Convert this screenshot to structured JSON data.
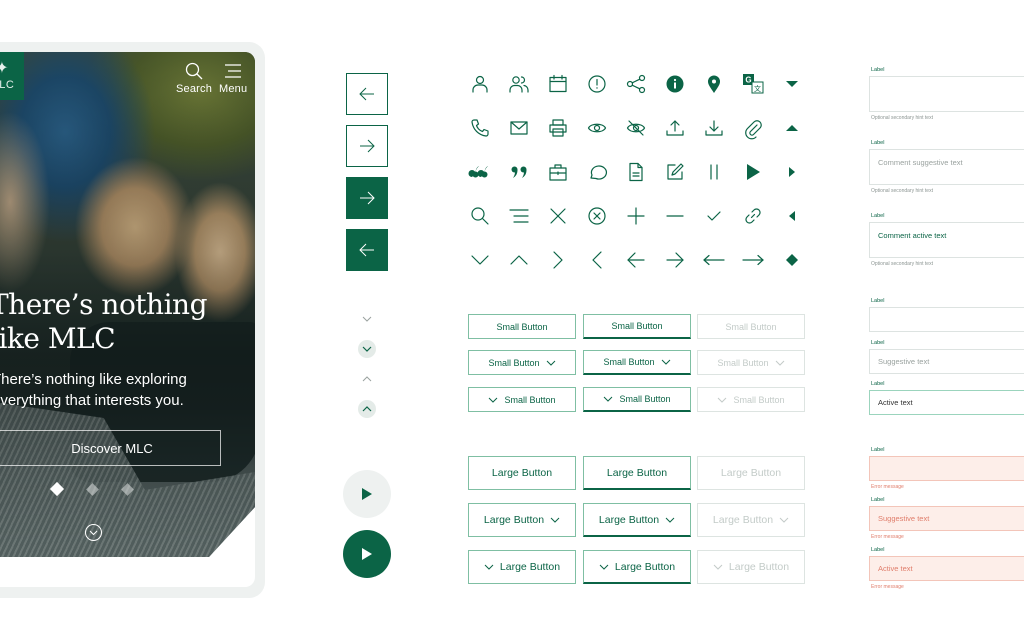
{
  "phone": {
    "logo_text": "MLC",
    "search_label": "Search",
    "menu_label": "Menu",
    "hero_title_line1": "There’s nothing",
    "hero_title_line2": "like MLC",
    "hero_sub_line1": "There’s nothing like exploring",
    "hero_sub_line2": "everything that interests you.",
    "cta_label": "Discover MLC",
    "carousel": {
      "count": 3,
      "active_index": 0
    }
  },
  "nav_buttons": [
    {
      "icon": "arrow-left-icon",
      "style": "outline"
    },
    {
      "icon": "arrow-right-icon",
      "style": "outline"
    },
    {
      "icon": "arrow-right-icon",
      "style": "filled"
    },
    {
      "icon": "arrow-left-icon",
      "style": "filled"
    }
  ],
  "chevron_buttons": [
    {
      "icon": "chevron-down-icon",
      "state": "default"
    },
    {
      "icon": "chevron-down-icon",
      "state": "hover"
    },
    {
      "icon": "chevron-up-icon",
      "state": "default"
    },
    {
      "icon": "chevron-up-icon",
      "state": "hover"
    }
  ],
  "play_buttons": [
    {
      "icon": "play-icon",
      "style": "light"
    },
    {
      "icon": "play-icon",
      "style": "dark"
    }
  ],
  "icon_grid": [
    [
      "user-icon",
      "users-icon",
      "calendar-icon",
      "alert-circle-icon",
      "share-icon",
      "info-filled-icon",
      "location-pin-icon",
      "google-translate-icon",
      "caret-down-icon"
    ],
    [
      "phone-icon",
      "mail-icon",
      "printer-icon",
      "eye-icon",
      "eye-off-icon",
      "upload-icon",
      "download-icon",
      "paperclip-icon",
      "caret-up-icon"
    ],
    [
      "quote-open-icon",
      "quote-close-icon",
      "briefcase-icon",
      "chat-bubble-icon",
      "document-icon",
      "edit-icon",
      "pause-icon",
      "play-large-icon",
      "caret-right-icon"
    ],
    [
      "search-icon",
      "menu-icon",
      "close-icon",
      "close-circle-icon",
      "plus-icon",
      "minus-icon",
      "check-icon",
      "link-icon",
      "caret-left-icon"
    ],
    [
      "chevron-down-icon",
      "chevron-up-icon",
      "chevron-right-icon",
      "chevron-left-icon",
      "arrow-left-icon",
      "arrow-right-icon",
      "long-arrow-left-icon",
      "long-arrow-right-icon",
      "diamond-icon"
    ]
  ],
  "buttons": {
    "small_label": "Small Button",
    "large_label": "Large Button",
    "states": [
      "default",
      "hover",
      "disabled"
    ],
    "variants": [
      "plain",
      "trailing-chevron",
      "leading-chevron"
    ]
  },
  "form": {
    "label": "Label",
    "hint": "Optional secondary hint text",
    "error": "Error message",
    "textareas": [
      {
        "value": "",
        "state": "empty"
      },
      {
        "value": "Comment suggestive text",
        "state": "placeholder"
      },
      {
        "value": "Comment active text",
        "state": "active"
      }
    ],
    "inputs": [
      {
        "value": "",
        "state": "empty"
      },
      {
        "value": "Suggestive text",
        "state": "placeholder"
      },
      {
        "value": "Active text",
        "state": "focused"
      }
    ],
    "error_inputs": [
      {
        "value": "",
        "state": "error"
      },
      {
        "value": "Suggestive text",
        "state": "error"
      },
      {
        "value": "Active text",
        "state": "error"
      }
    ]
  },
  "colors": {
    "brand_green": "#0b6446",
    "light_green_border": "#7fbfa3",
    "disabled_grey": "#c3cbc8",
    "error_fill": "#fdeee9",
    "error_text": "#e07e6c"
  }
}
